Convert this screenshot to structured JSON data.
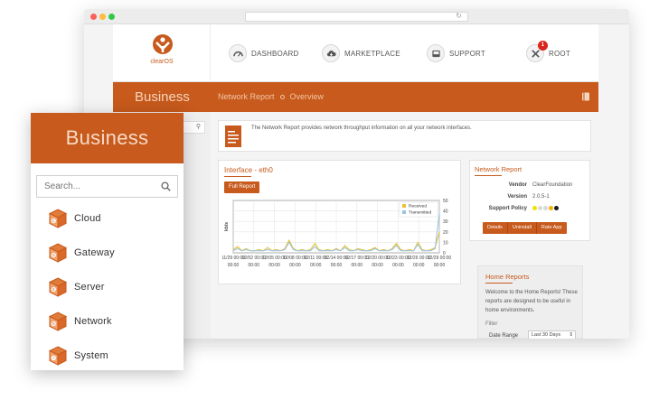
{
  "brand": {
    "color": "#c75a1c",
    "logo_text": "clearOS"
  },
  "topnav": {
    "items": [
      {
        "label": "DASHBOARD",
        "icon": "dashboard-icon"
      },
      {
        "label": "MARKETPLACE",
        "icon": "cloud-download-icon"
      },
      {
        "label": "SUPPORT",
        "icon": "inbox-icon"
      },
      {
        "label": "ROOT",
        "icon": "tools-icon",
        "badge": "1"
      }
    ]
  },
  "header": {
    "app_title": "Business",
    "breadcrumb": [
      "Network Report",
      "Overview"
    ]
  },
  "info": {
    "text": "The Network Report provides network throughput information on all your network interfaces."
  },
  "interface_panel": {
    "title": "Interface - eth0",
    "button": "Full Report"
  },
  "chart_data": {
    "type": "line",
    "ylabel": "kb/s",
    "y_right_ticks": [
      "50",
      "40",
      "30",
      "20",
      "10",
      "0"
    ],
    "ylim": [
      0,
      50
    ],
    "x_ticks": [
      "11/29 00:00",
      "12/02 00:00",
      "12/05 00:00",
      "12/08 00:00",
      "12/11 00:00",
      "12/14 00:00",
      "12/17 00:00",
      "12/20 00:00",
      "12/23 00:00",
      "12/26 00:00",
      "12/29 00:00"
    ],
    "legend": [
      "Received",
      "Transmitted"
    ],
    "legend_position": "top-right",
    "grid": true,
    "series": [
      {
        "name": "Received",
        "color": "#e8c234",
        "values": [
          3,
          6,
          2,
          4,
          2,
          2,
          3,
          2,
          5,
          2,
          3,
          2,
          4,
          12,
          4,
          2,
          3,
          2,
          3,
          9,
          3,
          2,
          3,
          2,
          4,
          2,
          7,
          3,
          2,
          4,
          3,
          2,
          3,
          5,
          2,
          3,
          2,
          4,
          9,
          3,
          2,
          3,
          2,
          10,
          3,
          2,
          3,
          5,
          20
        ]
      },
      {
        "name": "Transmitted",
        "color": "#9ac4e0",
        "values": [
          2,
          4,
          2,
          3,
          2,
          2,
          2,
          2,
          3,
          2,
          2,
          2,
          3,
          10,
          3,
          2,
          2,
          2,
          2,
          6,
          2,
          2,
          2,
          2,
          3,
          2,
          5,
          2,
          2,
          3,
          2,
          2,
          2,
          4,
          2,
          2,
          2,
          3,
          7,
          2,
          2,
          2,
          2,
          8,
          2,
          2,
          2,
          4,
          38
        ]
      }
    ]
  },
  "network_report": {
    "title": "Network Report",
    "rows": [
      {
        "key": "Vendor",
        "value": "ClearFoundation"
      },
      {
        "key": "Version",
        "value": "2.0.5-1"
      },
      {
        "key": "Support Policy",
        "value": ""
      }
    ],
    "policy_colors": [
      "#f0e200",
      "#d9d9d9",
      "#d9d9d9",
      "#f3b600",
      "#1a1a1a"
    ],
    "buttons": [
      "Details",
      "Uninstall",
      "Rate App"
    ]
  },
  "home_reports": {
    "title": "Home Reports",
    "desc": "Welcome to the Home Reports! These reports are designed to be useful in home environments.",
    "filter_label": "Filter",
    "date_range_label": "Date Range",
    "date_range_value": "Last 30 Days"
  },
  "card": {
    "title": "Business",
    "search_placeholder": "Search...",
    "items": [
      {
        "label": "Cloud",
        "letter": "C"
      },
      {
        "label": "Gateway",
        "letter": "G"
      },
      {
        "label": "Server",
        "letter": "S"
      },
      {
        "label": "Network",
        "letter": "N"
      },
      {
        "label": "System",
        "letter": "+"
      }
    ]
  }
}
